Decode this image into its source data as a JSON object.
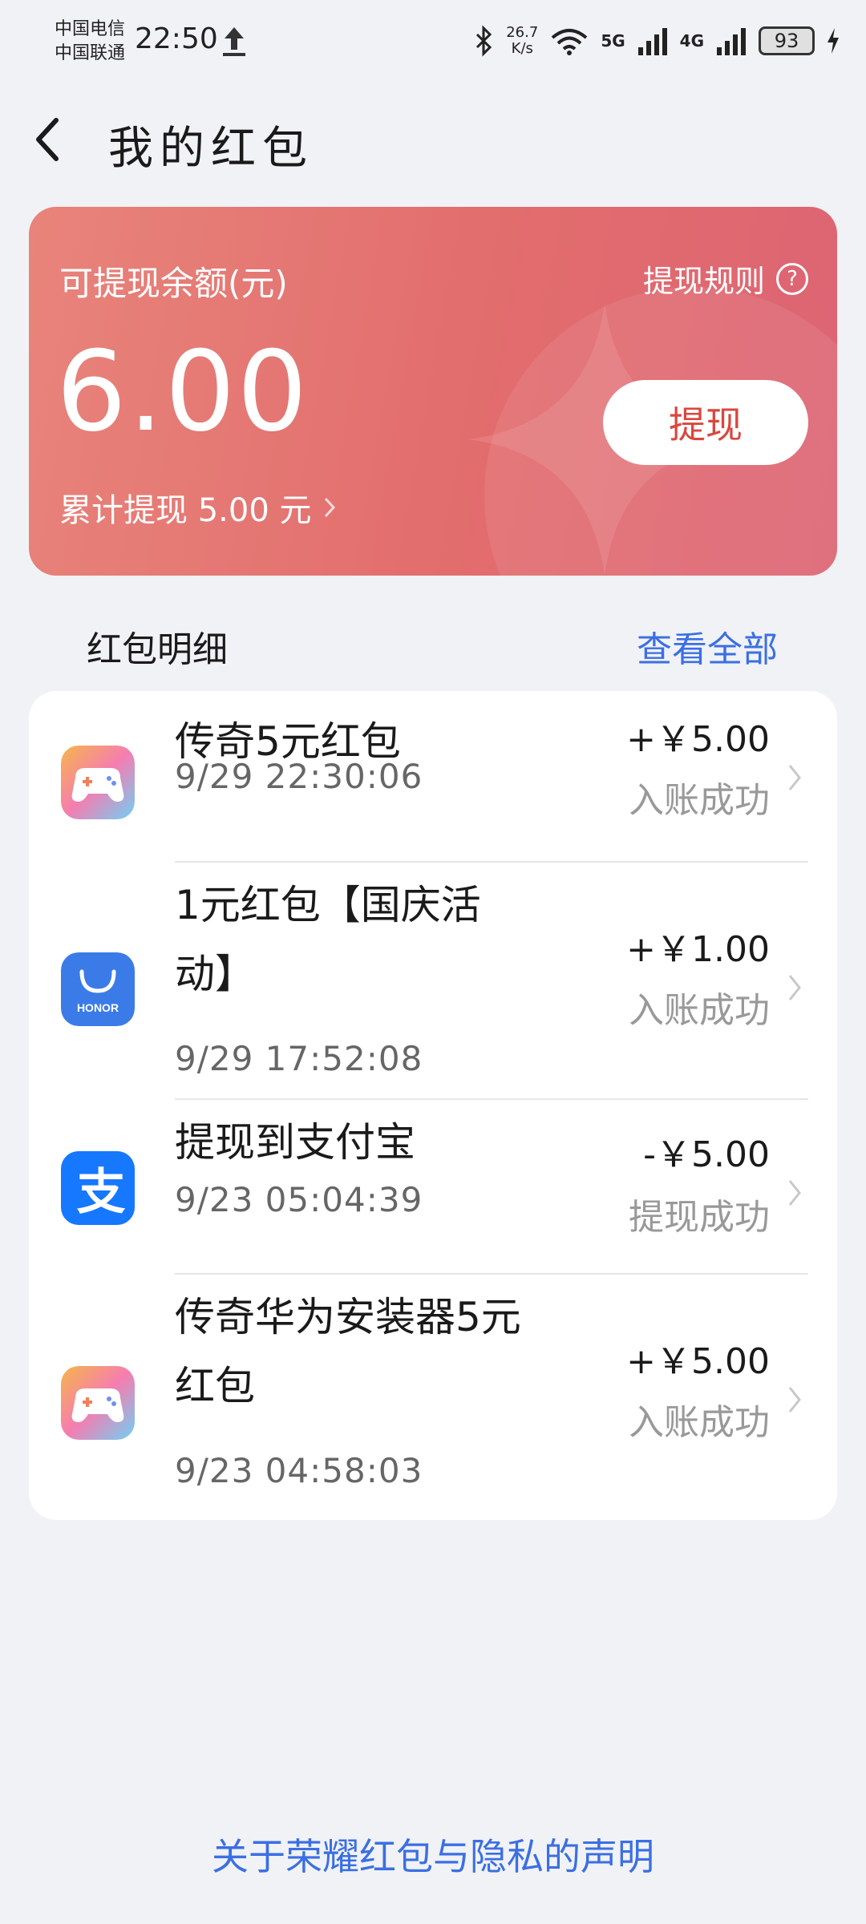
{
  "status_bar": {
    "carrier1": "中国电信",
    "carrier2": "中国联通",
    "time": "22:50",
    "net_speed_value": "26.7",
    "net_speed_unit": "K/s",
    "signal1": "5G",
    "signal2": "4G",
    "battery": "93"
  },
  "header": {
    "title": "我的红包"
  },
  "balance": {
    "label": "可提现余额(元)",
    "rules_label": "提现规则",
    "amount": "6.00",
    "withdraw_label": "提现",
    "total_withdrawn": "累计提现 5.00 元"
  },
  "section": {
    "title": "红包明细",
    "view_all": "查看全部"
  },
  "items": [
    {
      "icon": "game-controller-icon",
      "title": "传奇5元红包",
      "time": "9/29 22:30:06",
      "amount": "+￥5.00",
      "status": "入账成功"
    },
    {
      "icon": "honor-store-icon",
      "title": "1元红包【国庆活动】",
      "time": "9/29 17:52:08",
      "amount": "+￥1.00",
      "status": "入账成功"
    },
    {
      "icon": "alipay-icon",
      "title": "提现到支付宝",
      "time": "9/23 05:04:39",
      "amount": "-￥5.00",
      "status": "提现成功"
    },
    {
      "icon": "game-controller-icon",
      "title": "传奇华为安装器5元红包",
      "time": "9/23 04:58:03",
      "amount": "+￥5.00",
      "status": "入账成功"
    }
  ],
  "footer": {
    "privacy_link": "关于荣耀红包与隐私的声明"
  },
  "colors": {
    "card_red": "#e26d6d",
    "link_blue": "#3b6fe3",
    "withdraw_text": "#d9473f"
  }
}
